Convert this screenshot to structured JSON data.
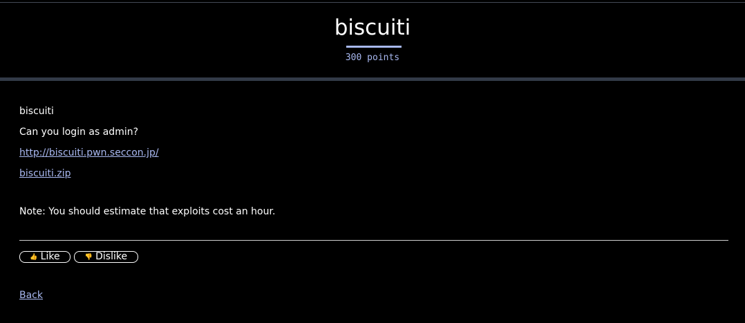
{
  "challenge": {
    "title": "biscuiti",
    "points": "300 points"
  },
  "description": {
    "name": "biscuiti",
    "question": "Can you login as admin?",
    "url": "http://biscuiti.pwn.seccon.jp/",
    "file": "biscuiti.zip",
    "note": "Note: You should estimate that exploits cost an hour."
  },
  "votes": {
    "like_icon": "thumbs-up-icon",
    "like_label": "Like",
    "dislike_icon": "thumbs-down-icon",
    "dislike_label": "Dislike"
  },
  "nav": {
    "back_label": "Back"
  },
  "colors": {
    "background": "#000000",
    "accent": "#a8b8f0",
    "header_rule": "#323a47",
    "text": "#ffffff"
  }
}
